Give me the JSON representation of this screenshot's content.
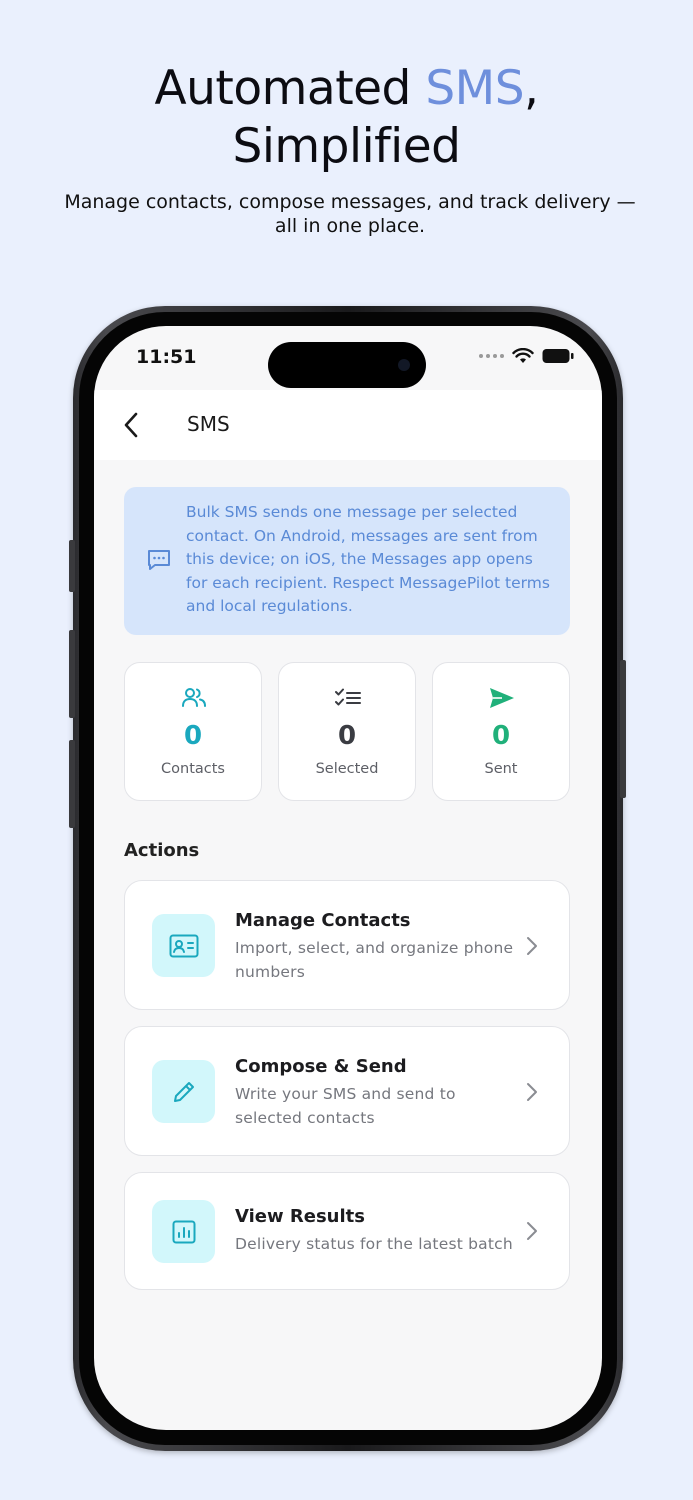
{
  "hero": {
    "title_part1": "Automated ",
    "title_accent": "SMS",
    "title_part2": ",",
    "title_line2": "Simplified",
    "subtitle": "Manage contacts, compose messages, and track delivery — all in one place."
  },
  "status_bar": {
    "time": "11:51"
  },
  "app_bar": {
    "title": "SMS",
    "back_icon": "chevron-left-icon"
  },
  "info_banner": {
    "icon": "message-dots-icon",
    "text": "Bulk SMS sends one message per selected contact. On Android, messages are sent from this device; on iOS, the Messages app opens for each recipient. Respect MessagePilot terms and local regulations."
  },
  "stats": [
    {
      "icon": "users-icon",
      "value": "0",
      "label": "Contacts",
      "color": "#1aa8be"
    },
    {
      "icon": "checklist-icon",
      "value": "0",
      "label": "Selected",
      "color": "#3a3c42"
    },
    {
      "icon": "send-icon",
      "value": "0",
      "label": "Sent",
      "color": "#20b07a"
    }
  ],
  "actions_label": "Actions",
  "actions": [
    {
      "icon": "contact-card-icon",
      "title": "Manage Contacts",
      "description": "Import, select, and organize phone numbers"
    },
    {
      "icon": "pencil-icon",
      "title": "Compose & Send",
      "description": "Write your SMS and send to selected contacts"
    },
    {
      "icon": "bar-chart-icon",
      "title": "View Results",
      "description": "Delivery status for the latest batch"
    }
  ],
  "colors": {
    "accent": "#6e8fdc",
    "teal": "#1aa8be",
    "green": "#20b07a",
    "banner_bg": "#d6e5fb",
    "banner_text": "#5a8ad6",
    "icon_tile_bg": "#d2f7fb"
  }
}
